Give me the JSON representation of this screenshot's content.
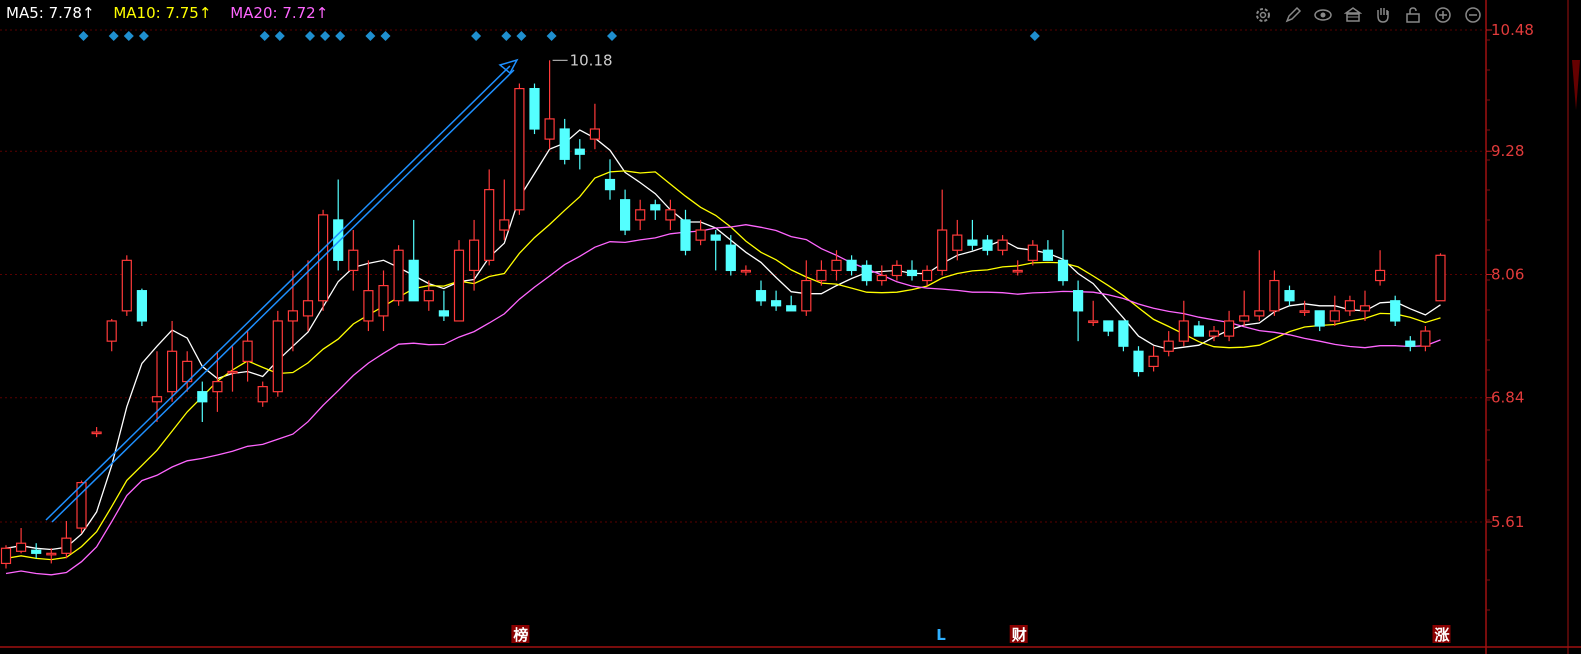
{
  "legend": {
    "ma5": {
      "label": "MA5: 7.78↑",
      "color": "#ffffff"
    },
    "ma10": {
      "label": "MA10: 7.75↑",
      "color": "#ffff00"
    },
    "ma20": {
      "label": "MA20: 7.72↑",
      "color": "#ff66ff"
    }
  },
  "toolbar": [
    "settings-icon",
    "pen-icon",
    "eye-icon",
    "bank-icon",
    "hand-icon",
    "lock-icon",
    "zoom-in-icon",
    "zoom-out-icon"
  ],
  "colors": {
    "up": "#ff3a3a",
    "down": "#54ffff",
    "grid": "#5a0000",
    "diamond": "#1f8fcf",
    "arrow": "#1e90ff"
  },
  "high_label": "10.18",
  "bottom_markers": [
    {
      "text": "榜",
      "style": "box",
      "index": 34
    },
    {
      "text": "L",
      "style": "plain",
      "index": 62
    },
    {
      "text": "财",
      "style": "box",
      "index": 67
    },
    {
      "text": "涨",
      "style": "box",
      "index": 95
    }
  ],
  "diamond_indices": [
    5,
    7,
    8,
    9,
    17,
    18,
    20,
    21,
    22,
    24,
    25,
    31,
    33,
    34,
    36,
    40,
    68
  ],
  "chart_data": {
    "type": "candlestick",
    "y_ticks": [
      "10.48",
      "9.28",
      "8.06",
      "6.84",
      "5.61"
    ],
    "ylim": [
      4.45,
      10.6
    ],
    "x_count": 96,
    "candles": [
      [
        5.2,
        5.35,
        5.15,
        5.38
      ],
      [
        5.32,
        5.4,
        5.3,
        5.55
      ],
      [
        5.33,
        5.3,
        5.25,
        5.4
      ],
      [
        5.3,
        5.3,
        5.2,
        5.35
      ],
      [
        5.3,
        5.45,
        5.25,
        5.62
      ],
      [
        5.55,
        6.0,
        5.5,
        6.02
      ],
      [
        6.5,
        6.5,
        6.45,
        6.55
      ],
      [
        7.4,
        7.6,
        7.3,
        7.62
      ],
      [
        7.7,
        8.2,
        7.65,
        8.25
      ],
      [
        7.9,
        7.6,
        7.55,
        7.92
      ],
      [
        6.8,
        6.85,
        6.6,
        7.3
      ],
      [
        6.9,
        7.3,
        6.8,
        7.6
      ],
      [
        7.0,
        7.2,
        6.9,
        7.3
      ],
      [
        6.9,
        6.8,
        6.6,
        7.0
      ],
      [
        6.9,
        7.0,
        6.7,
        7.3
      ],
      [
        7.1,
        7.1,
        6.9,
        7.35
      ],
      [
        7.2,
        7.4,
        7.0,
        7.5
      ],
      [
        6.8,
        6.95,
        6.75,
        7.0
      ],
      [
        6.9,
        7.6,
        6.85,
        7.7
      ],
      [
        7.6,
        7.7,
        7.3,
        8.1
      ],
      [
        7.65,
        7.8,
        7.5,
        8.2
      ],
      [
        7.8,
        8.65,
        7.7,
        8.7
      ],
      [
        8.6,
        8.2,
        8.1,
        9.0
      ],
      [
        8.1,
        8.3,
        7.9,
        8.5
      ],
      [
        7.6,
        7.9,
        7.5,
        8.2
      ],
      [
        7.65,
        7.95,
        7.5,
        8.1
      ],
      [
        7.8,
        8.3,
        7.75,
        8.35
      ],
      [
        8.2,
        7.8,
        7.8,
        8.6
      ],
      [
        7.8,
        7.9,
        7.7,
        8.0
      ],
      [
        7.7,
        7.65,
        7.6,
        7.9
      ],
      [
        7.6,
        8.3,
        7.6,
        8.4
      ],
      [
        8.1,
        8.4,
        7.9,
        8.6
      ],
      [
        8.2,
        8.9,
        8.15,
        9.1
      ],
      [
        8.5,
        8.6,
        8.4,
        9.0
      ],
      [
        8.7,
        9.9,
        8.65,
        9.95
      ],
      [
        9.9,
        9.5,
        9.45,
        9.95
      ],
      [
        9.4,
        9.6,
        9.3,
        10.18
      ],
      [
        9.5,
        9.2,
        9.15,
        9.6
      ],
      [
        9.3,
        9.25,
        9.1,
        9.4
      ],
      [
        9.4,
        9.5,
        9.3,
        9.75
      ],
      [
        9.0,
        8.9,
        8.8,
        9.2
      ],
      [
        8.8,
        8.5,
        8.45,
        8.9
      ],
      [
        8.6,
        8.7,
        8.5,
        8.8
      ],
      [
        8.75,
        8.7,
        8.6,
        8.8
      ],
      [
        8.6,
        8.7,
        8.5,
        8.8
      ],
      [
        8.6,
        8.3,
        8.25,
        8.7
      ],
      [
        8.4,
        8.5,
        8.35,
        8.6
      ],
      [
        8.45,
        8.4,
        8.1,
        8.5
      ],
      [
        8.35,
        8.1,
        8.05,
        8.45
      ],
      [
        8.1,
        8.1,
        8.05,
        8.15
      ],
      [
        7.9,
        7.8,
        7.75,
        8.0
      ],
      [
        7.8,
        7.75,
        7.7,
        7.9
      ],
      [
        7.75,
        7.7,
        7.7,
        7.85
      ],
      [
        7.7,
        8.0,
        7.65,
        8.2
      ],
      [
        8.0,
        8.1,
        7.95,
        8.2
      ],
      [
        8.1,
        8.2,
        8.0,
        8.3
      ],
      [
        8.2,
        8.1,
        8.05,
        8.25
      ],
      [
        8.15,
        8.0,
        7.95,
        8.2
      ],
      [
        8.0,
        8.05,
        7.95,
        8.15
      ],
      [
        8.05,
        8.15,
        8.0,
        8.2
      ],
      [
        8.1,
        8.05,
        8.0,
        8.2
      ],
      [
        8.0,
        8.1,
        7.95,
        8.15
      ],
      [
        8.1,
        8.5,
        8.05,
        8.9
      ],
      [
        8.3,
        8.45,
        8.2,
        8.6
      ],
      [
        8.4,
        8.35,
        8.3,
        8.6
      ],
      [
        8.4,
        8.3,
        8.25,
        8.45
      ],
      [
        8.3,
        8.4,
        8.25,
        8.45
      ],
      [
        8.1,
        8.1,
        8.05,
        8.2
      ],
      [
        8.2,
        8.35,
        8.15,
        8.4
      ],
      [
        8.3,
        8.2,
        8.2,
        8.4
      ],
      [
        8.2,
        8.0,
        7.95,
        8.5
      ],
      [
        7.9,
        7.7,
        7.4,
        8.0
      ],
      [
        7.6,
        7.6,
        7.55,
        7.8
      ],
      [
        7.6,
        7.5,
        7.45,
        7.6
      ],
      [
        7.6,
        7.35,
        7.3,
        7.6
      ],
      [
        7.3,
        7.1,
        7.05,
        7.35
      ],
      [
        7.15,
        7.25,
        7.1,
        7.35
      ],
      [
        7.3,
        7.4,
        7.25,
        7.5
      ],
      [
        7.4,
        7.6,
        7.35,
        7.8
      ],
      [
        7.55,
        7.45,
        7.45,
        7.6
      ],
      [
        7.45,
        7.5,
        7.4,
        7.55
      ],
      [
        7.45,
        7.6,
        7.4,
        7.7
      ],
      [
        7.6,
        7.65,
        7.55,
        7.9
      ],
      [
        7.65,
        7.7,
        7.6,
        8.3
      ],
      [
        7.7,
        8.0,
        7.65,
        8.1
      ],
      [
        7.9,
        7.8,
        7.75,
        7.95
      ],
      [
        7.7,
        7.7,
        7.65,
        7.8
      ],
      [
        7.7,
        7.55,
        7.5,
        7.7
      ],
      [
        7.6,
        7.7,
        7.55,
        7.85
      ],
      [
        7.7,
        7.8,
        7.65,
        7.85
      ],
      [
        7.7,
        7.75,
        7.6,
        7.9
      ],
      [
        8.0,
        8.1,
        7.95,
        8.3
      ],
      [
        7.8,
        7.6,
        7.55,
        7.85
      ],
      [
        7.4,
        7.35,
        7.3,
        7.45
      ],
      [
        7.35,
        7.5,
        7.3,
        7.55
      ],
      [
        7.8,
        8.25,
        7.8,
        8.27
      ]
    ]
  }
}
